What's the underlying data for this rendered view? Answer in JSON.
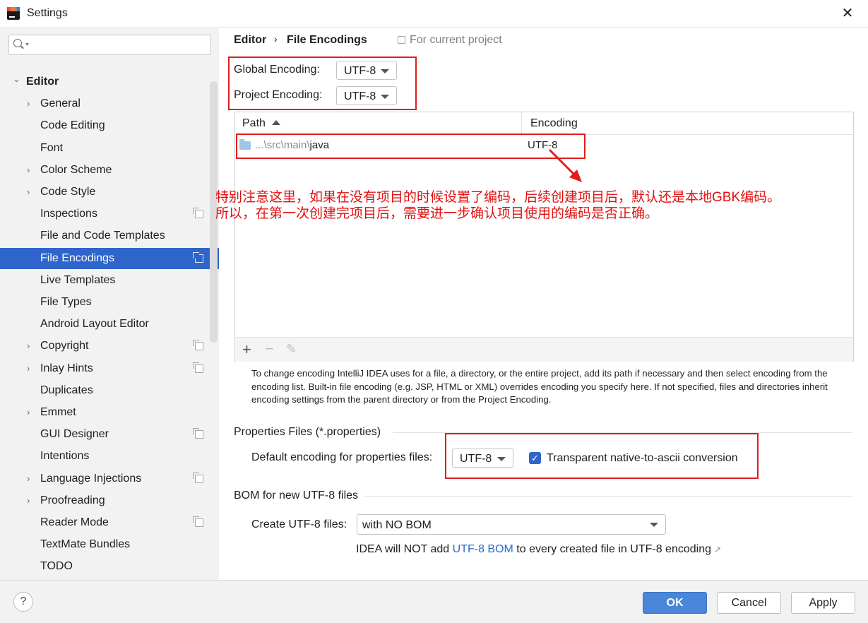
{
  "window": {
    "title": "Settings"
  },
  "sidebar": {
    "search_placeholder": "",
    "items": [
      {
        "label": "Editor",
        "level": 0,
        "expandable": true,
        "expanded": true,
        "project_scoped": false,
        "selected": false
      },
      {
        "label": "General",
        "level": 1,
        "expandable": true,
        "project_scoped": false,
        "selected": false
      },
      {
        "label": "Code Editing",
        "level": 1,
        "expandable": false,
        "project_scoped": false,
        "selected": false
      },
      {
        "label": "Font",
        "level": 1,
        "expandable": false,
        "project_scoped": false,
        "selected": false
      },
      {
        "label": "Color Scheme",
        "level": 1,
        "expandable": true,
        "project_scoped": false,
        "selected": false
      },
      {
        "label": "Code Style",
        "level": 1,
        "expandable": true,
        "project_scoped": false,
        "selected": false
      },
      {
        "label": "Inspections",
        "level": 1,
        "expandable": false,
        "project_scoped": true,
        "selected": false
      },
      {
        "label": "File and Code Templates",
        "level": 1,
        "expandable": false,
        "project_scoped": false,
        "selected": false
      },
      {
        "label": "File Encodings",
        "level": 1,
        "expandable": false,
        "project_scoped": true,
        "selected": true
      },
      {
        "label": "Live Templates",
        "level": 1,
        "expandable": false,
        "project_scoped": false,
        "selected": false
      },
      {
        "label": "File Types",
        "level": 1,
        "expandable": false,
        "project_scoped": false,
        "selected": false
      },
      {
        "label": "Android Layout Editor",
        "level": 1,
        "expandable": false,
        "project_scoped": false,
        "selected": false
      },
      {
        "label": "Copyright",
        "level": 1,
        "expandable": true,
        "project_scoped": true,
        "selected": false
      },
      {
        "label": "Inlay Hints",
        "level": 1,
        "expandable": true,
        "project_scoped": true,
        "selected": false
      },
      {
        "label": "Duplicates",
        "level": 1,
        "expandable": false,
        "project_scoped": false,
        "selected": false
      },
      {
        "label": "Emmet",
        "level": 1,
        "expandable": true,
        "project_scoped": false,
        "selected": false
      },
      {
        "label": "GUI Designer",
        "level": 1,
        "expandable": false,
        "project_scoped": true,
        "selected": false
      },
      {
        "label": "Intentions",
        "level": 1,
        "expandable": false,
        "project_scoped": false,
        "selected": false
      },
      {
        "label": "Language Injections",
        "level": 1,
        "expandable": true,
        "project_scoped": true,
        "selected": false
      },
      {
        "label": "Proofreading",
        "level": 1,
        "expandable": true,
        "project_scoped": false,
        "selected": false
      },
      {
        "label": "Reader Mode",
        "level": 1,
        "expandable": false,
        "project_scoped": true,
        "selected": false
      },
      {
        "label": "TextMate Bundles",
        "level": 1,
        "expandable": false,
        "project_scoped": false,
        "selected": false
      },
      {
        "label": "TODO",
        "level": 1,
        "expandable": false,
        "project_scoped": false,
        "selected": false
      }
    ]
  },
  "breadcrumb": {
    "parent": "Editor",
    "separator": "›",
    "current": "File Encodings",
    "scope": "For current project"
  },
  "global_encoding": {
    "label": "Global Encoding:",
    "value": "UTF-8"
  },
  "project_encoding": {
    "label": "Project Encoding:",
    "value": "UTF-8"
  },
  "table": {
    "columns": [
      "Path",
      "Encoding"
    ],
    "rows": [
      {
        "path_prefix": "...\\src\\main\\",
        "path_name": "java",
        "encoding": "UTF-8"
      }
    ],
    "toolbar": {
      "add": "+",
      "remove": "−",
      "edit": "✎"
    }
  },
  "help_text": "To change encoding IntelliJ IDEA uses for a file, a directory, or the entire project, add its path if necessary and then select encoding from the encoding list. Built-in file encoding (e.g. JSP, HTML or XML) overrides encoding you specify here. If not specified, files and directories inherit encoding settings from the parent directory or from the Project Encoding.",
  "properties": {
    "title": "Properties Files (*.properties)",
    "label": "Default encoding for properties files:",
    "value": "UTF-8",
    "checkbox_label": "Transparent native-to-ascii conversion",
    "checkbox_checked": true
  },
  "bom": {
    "title": "BOM for new UTF-8 files",
    "label": "Create UTF-8 files:",
    "value": "with NO BOM",
    "note_prefix": "IDEA will NOT add ",
    "note_link": "UTF-8 BOM",
    "note_suffix": " to every created file in UTF-8 encoding"
  },
  "footer": {
    "help": "?",
    "ok": "OK",
    "cancel": "Cancel",
    "apply": "Apply"
  },
  "annotation": {
    "line1": "特别注意这里，如果在没有项目的时候设置了编码，后续创建项目后，默认还是本地GBK编码。",
    "line2": "所以，在第一次创建完项目后，需要进一步确认项目使用的编码是否正确。",
    "color": "#e01010"
  },
  "colors": {
    "selection": "#2f65ca",
    "ok_button": "#4a86d9",
    "link": "#2b6bcc",
    "annotation_red": "#e11d1d"
  }
}
